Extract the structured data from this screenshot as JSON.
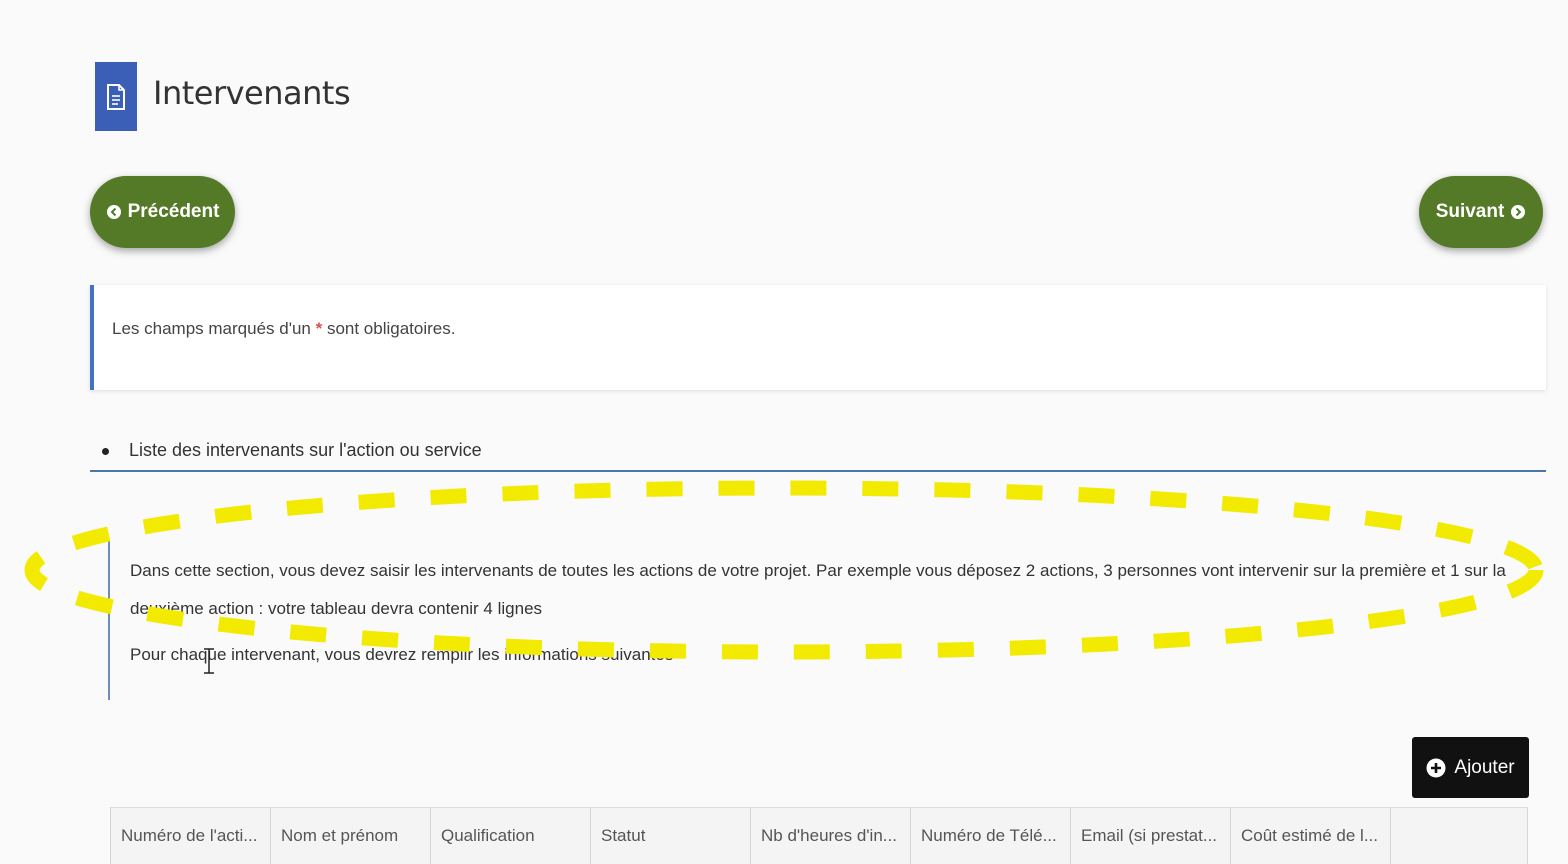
{
  "page": {
    "title": "Intervenants",
    "icon": "document-icon"
  },
  "nav": {
    "prev_label": "Précédent",
    "next_label": "Suivant",
    "button_color": "#557a27"
  },
  "notice": {
    "text_before": "Les champs marqués d'un",
    "star": "*",
    "text_after": "sont obligatoires."
  },
  "section": {
    "title": "Liste des intervenants sur l'action ou service"
  },
  "description": {
    "paragraph1": "Dans cette section, vous devez saisir les intervenants de toutes les actions de votre projet. Par exemple vous déposez 2 actions, 3 personnes vont intervenir sur la première et 1 sur la deuxième action : votre tableau devra contenir 4 lignes",
    "paragraph2": "Pour chaque intervenant, vous devrez remplir les informations suivantes"
  },
  "toolbar": {
    "add_label": "Ajouter"
  },
  "table": {
    "columns": [
      "Numéro de l'acti...",
      "Nom et prénom",
      "Qualification",
      "Statut",
      "Nb d'heures d'in...",
      "Numéro de Télé...",
      "Email (si prestat...",
      "Coût estimé de l...",
      ""
    ]
  },
  "colors": {
    "accent_blue": "#3b5fb6",
    "highlight": "#f2ea00",
    "required": "#d9534f"
  }
}
